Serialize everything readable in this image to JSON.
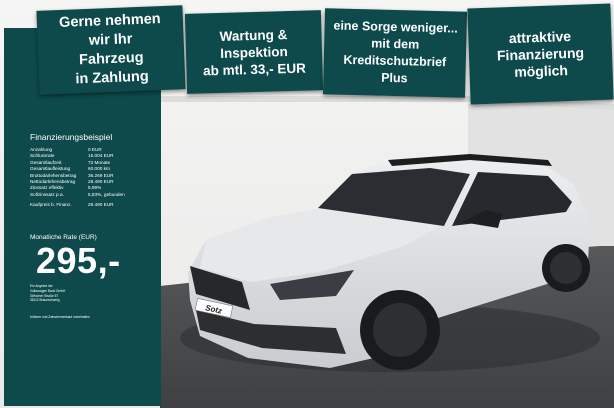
{
  "banners": [
    {
      "lines": [
        "Gerne nehmen",
        "wir Ihr",
        "Fahrzeug",
        "in Zahlung"
      ]
    },
    {
      "lines": [
        "Wartung &",
        "Inspektion",
        "ab mtl. 33,- EUR"
      ]
    },
    {
      "lines": [
        "eine Sorge weniger...",
        "mit dem",
        "Kreditschutzbrief",
        "Plus"
      ]
    },
    {
      "lines": [
        "attraktive",
        "Finanzierung",
        "möglich"
      ]
    }
  ],
  "financing": {
    "title": "Finanzierungsbeispiel",
    "rows": [
      {
        "label": "Anzahlung",
        "value": "0 EUR"
      },
      {
        "label": "Schlussrate",
        "value": "15.004 EUR"
      },
      {
        "label": "Gesamtlaufzeit",
        "value": "72 Monate"
      },
      {
        "label": "Gesamtlaufleistung",
        "value": "60.000 km"
      },
      {
        "label": "Bruttodarlehensbetrag",
        "value": "36.269 EUR"
      },
      {
        "label": "Nettodarlehensbetrag",
        "value": "28.490 EUR"
      },
      {
        "label": "Zinssatz effektiv",
        "value": "5,99%"
      },
      {
        "label": "Sollzinssatz p.a.",
        "value": "5,83%, gebunden"
      }
    ],
    "purchase_label": "Kaufpreis b. Finanz.",
    "purchase_value": "28.490 EUR",
    "rate_label": "Monatliche Rate (EUR)",
    "rate_value": "295,-",
    "lender_lines": [
      "Ein Angebot der",
      "Volkswagen Bank GmbH",
      "Gifhorner Straße 57",
      "38112 Braunschweig"
    ],
    "footnote": "Irrtümer und Zwischenverkauf vorbehalten"
  },
  "vehicle": {
    "plate_text": "Sotz",
    "paint_color": "#dde0e4"
  },
  "colors": {
    "brand_teal": "#0e4a4c",
    "text": "#ffffff"
  }
}
